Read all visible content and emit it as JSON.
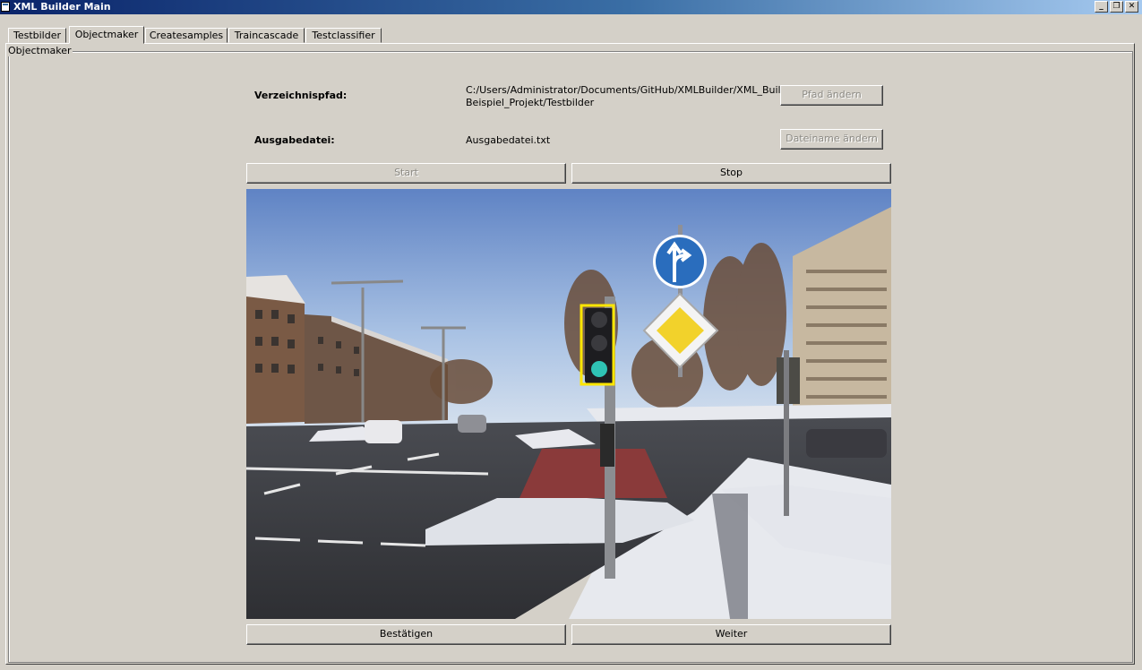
{
  "window": {
    "title": "XML Builder Main",
    "controls": [
      "_",
      "❐",
      "✕"
    ]
  },
  "tabs": [
    {
      "label": "Testbilder",
      "active": false
    },
    {
      "label": "Objectmaker",
      "active": true
    },
    {
      "label": "Createsamples",
      "active": false
    },
    {
      "label": "Traincascade",
      "active": false
    },
    {
      "label": "Testclassifier",
      "active": false
    }
  ],
  "group": {
    "label": "Objectmaker"
  },
  "form": {
    "directory_label": "Verzeichnispfad:",
    "directory_value_line1": "C:/Users/Administrator/Documents/GitHub/XMLBuilder/XML_Builder/",
    "directory_value_line2": "Beispiel_Projekt/Testbilder",
    "change_path_button": "Pfad ändern",
    "output_label": "Ausgabedatei:",
    "output_value": "Ausgabedatei.txt",
    "change_filename_button": "Dateiname ändern"
  },
  "controls": {
    "start_button": "Start",
    "stop_button": "Stop",
    "confirm_button": "Bestätigen",
    "next_button": "Weiter"
  },
  "image": {
    "description_icon": "street-scene-image",
    "selection_color": "#ffe600"
  }
}
